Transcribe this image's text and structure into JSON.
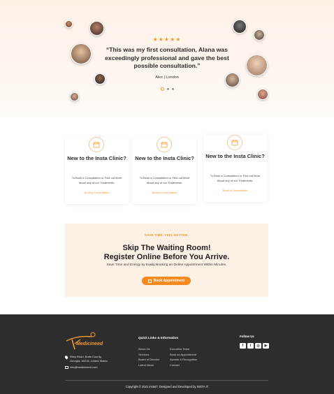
{
  "testimonial": {
    "rating_stars": "★★★★★",
    "quote": "“This was my first consultation, Alana was exceedingly professional and gave the best possible consultation.”",
    "author": "Alex | London",
    "slides": 3,
    "active_slide": 1
  },
  "cards": [
    {
      "icon": "calendar-icon",
      "title": "New to the Insta Clinic?",
      "description": "To Book a Consultation or Find out More About any of our Treatments.",
      "link": "Book a Consultation"
    },
    {
      "icon": "calendar-icon",
      "title": "New to the Insta Clinic?",
      "description": "To Book a Consultation or Find out More About any of our Treatments.",
      "link": "Book a Consultation"
    },
    {
      "icon": "calendar-icon",
      "title": "New to the Insta Clinic?",
      "description": "To Book a Consultation or Find out More About any of our Treatments.",
      "link": "Book a Consultation"
    }
  ],
  "banner": {
    "subtitle": "SAVE TIME. FEEL BETTER.",
    "title_line1": "Skip The Waiting Room!",
    "title_line2": "Register Online Before You Arrive.",
    "description": "Save Time and Energy by Easily Booking an Online Appointment Within Minutes.",
    "button_label": "Book Appointment"
  },
  "footer": {
    "logo_text": "Medicineed",
    "address_line1": "Riley Road, Butts County,",
    "address_line2": "Georgia, 30216, United States",
    "email": "info@medicineed.com",
    "quick_links_title": "Quick Links & Information",
    "quick_links_col1": [
      "About Us",
      "Services",
      "Board of Director",
      "Latest News"
    ],
    "quick_links_col2": [
      "Executive Team",
      "Book an Appointment",
      "Awards & Recognition",
      "Contact"
    ],
    "follow_title": "Follow Us",
    "socials": [
      "facebook-icon",
      "twitter-icon",
      "instagram-icon",
      "youtube-icon"
    ],
    "copyright": "Copyright © 2021 instaIT. Designed and Developed by INSTA IT"
  },
  "colors": {
    "accent": "#f59a2c",
    "footer_bg": "#2d2d2d",
    "banner_bg": "#fdf1e6"
  }
}
